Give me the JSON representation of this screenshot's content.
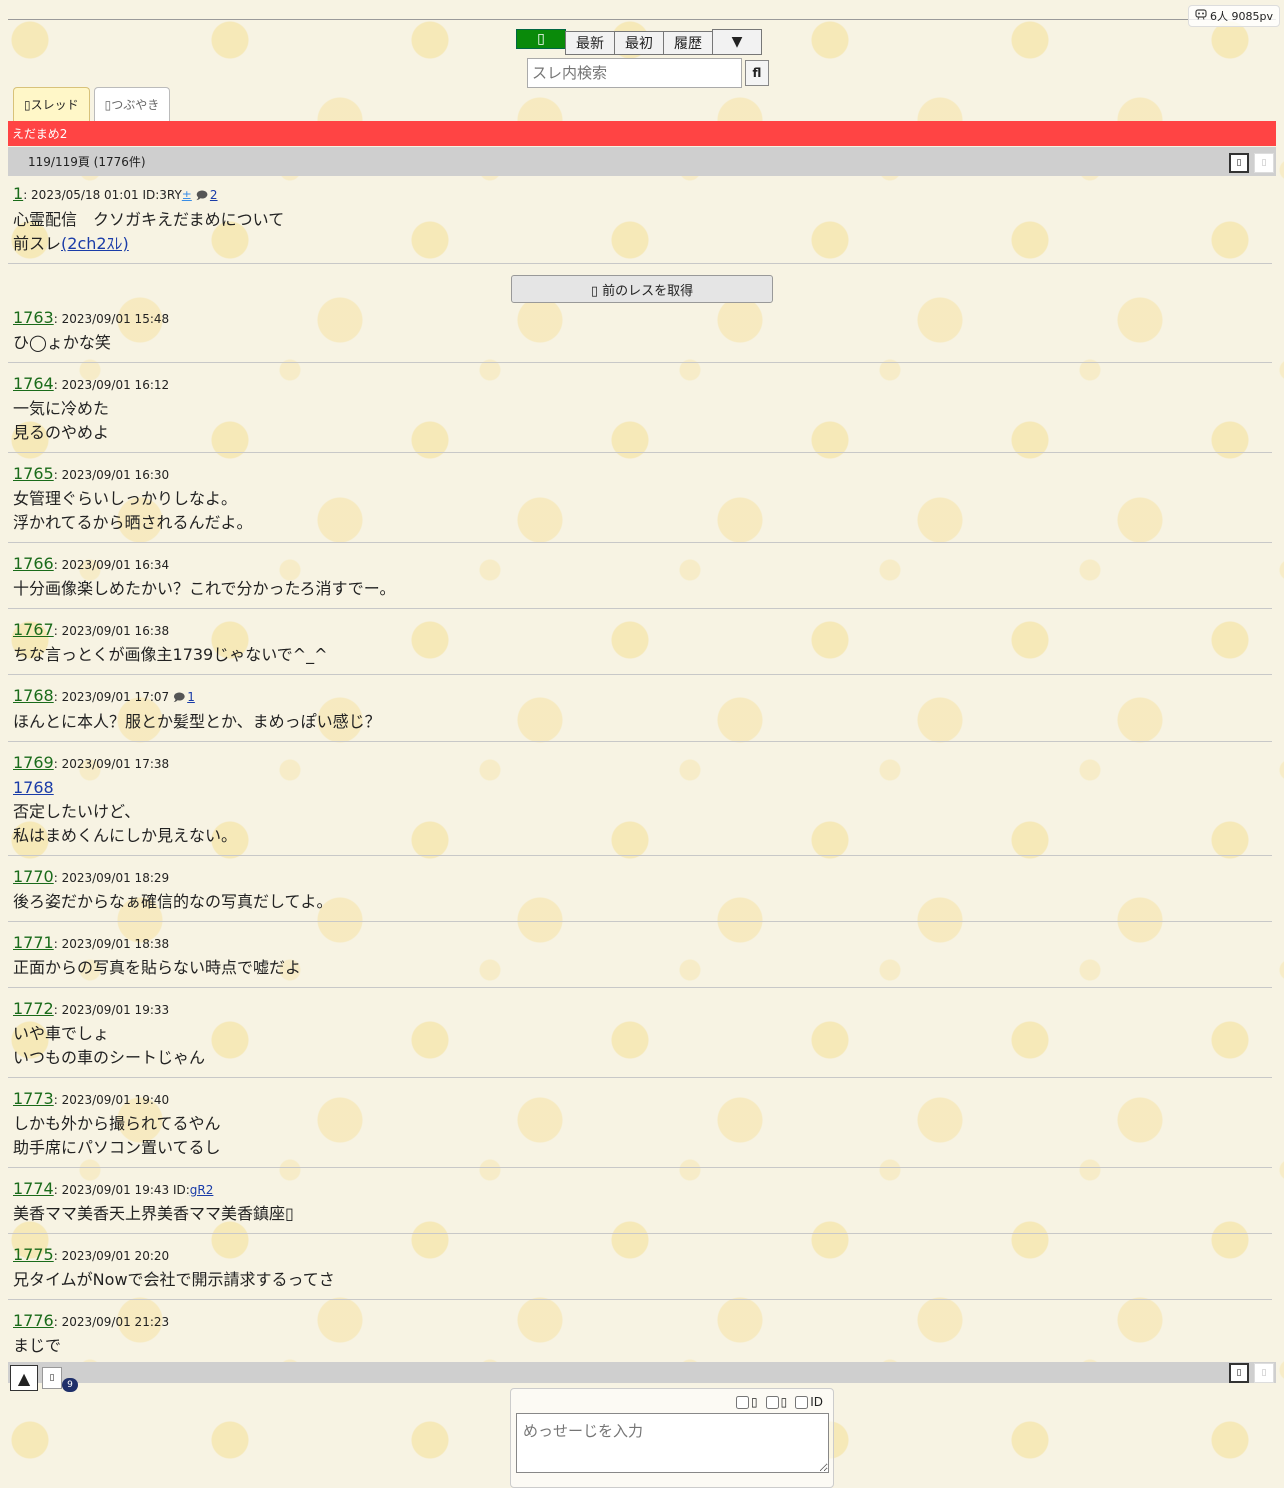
{
  "header": {
    "pv_icon": "viewer-icon",
    "pv_text": "6人 9085pv"
  },
  "toolbar": {
    "green_label": "▯",
    "latest": "最新",
    "first": "最初",
    "history": "履歴",
    "menu": "▼"
  },
  "search": {
    "placeholder": "スレ内検索",
    "button": "fl"
  },
  "tabs": [
    {
      "label": "▯スレッド"
    },
    {
      "label": "▯つぶやき"
    }
  ],
  "thread": {
    "title": "えだまめ2",
    "page_info": "119/119頁 (1776件)",
    "page_btn_1": "▯",
    "page_btn_2": "▯",
    "prev_button": "▯ 前のレスを取得"
  },
  "first_post": {
    "num": "1",
    "date": "2023/05/18 01:01",
    "id_prefix": "ID:3RY",
    "id_icon": "±",
    "reply_icon": "💬",
    "reply_count": "2",
    "line1": "心霊配信　クソガキえだまめについて",
    "line2_prefix": "前スレ",
    "line2_link": "(2ch2ｽﾚ)"
  },
  "posts": [
    {
      "num": "1763",
      "date": "2023/09/01 15:48",
      "lines": [
        "ひ◯ょかな笑"
      ]
    },
    {
      "num": "1764",
      "date": "2023/09/01 16:12",
      "lines": [
        "一気に冷めた",
        "見るのやめよ"
      ]
    },
    {
      "num": "1765",
      "date": "2023/09/01 16:30",
      "lines": [
        "女管理ぐらいしっかりしなよ。",
        "浮かれてるから晒されるんだよ。"
      ]
    },
    {
      "num": "1766",
      "date": "2023/09/01 16:34",
      "lines": [
        "十分画像楽しめたかい？これで分かったろ消すでー。"
      ]
    },
    {
      "num": "1767",
      "date": "2023/09/01 16:38",
      "lines": [
        "ちな言っとくが画像主1739じゃないで^_^"
      ]
    },
    {
      "num": "1768",
      "date": "2023/09/01 17:07",
      "reply_count": "1",
      "lines": [
        "ほんとに本人？服とか髪型とか、まめっぽい感じ？"
      ]
    },
    {
      "num": "1769",
      "date": "2023/09/01 17:38",
      "anchor": "1768",
      "lines": [
        "否定したいけど、",
        "私はまめくんにしか見えない。"
      ]
    },
    {
      "num": "1770",
      "date": "2023/09/01 18:29",
      "lines": [
        "後ろ姿だからなぁ確信的なの写真だしてよ。"
      ]
    },
    {
      "num": "1771",
      "date": "2023/09/01 18:38",
      "lines": [
        "正面からの写真を貼らない時点で嘘だよ"
      ]
    },
    {
      "num": "1772",
      "date": "2023/09/01 19:33",
      "lines": [
        "いや車でしょ",
        "いつもの車のシートじゃん"
      ]
    },
    {
      "num": "1773",
      "date": "2023/09/01 19:40",
      "lines": [
        "しかも外から撮られてるやん",
        "助手席にパソコン置いてるし"
      ]
    },
    {
      "num": "1774",
      "date": "2023/09/01 19:43",
      "id_prefix": "ID:",
      "id": "gR2",
      "lines": [
        "美香ママ美香天上界美香ママ美香鎮座▯"
      ]
    },
    {
      "num": "1775",
      "date": "2023/09/01 20:20",
      "lines": [
        "兄タイムがNowで会社で開示請求するってさ"
      ]
    },
    {
      "num": "1776",
      "date": "2023/09/01 21:23",
      "lines": [
        "まじで"
      ]
    }
  ],
  "bottom": {
    "up": "▲",
    "small": "▯",
    "badge": "9",
    "btn1": "▯",
    "btn2": "▯"
  },
  "form": {
    "opt1": "▯",
    "opt2": "▯",
    "opt3": "ID",
    "placeholder": "めっせーじを入力"
  }
}
